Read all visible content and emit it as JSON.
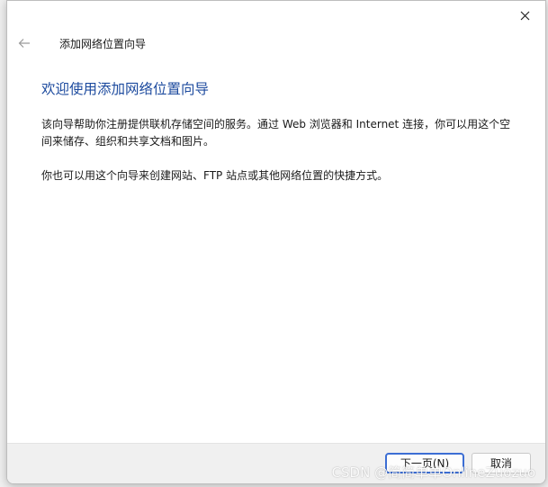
{
  "window": {
    "header_title": "添加网络位置向导"
  },
  "content": {
    "heading": "欢迎使用添加网络位置向导",
    "paragraph1": "该向导帮助你注册提供联机存储空间的服务。通过 Web 浏览器和 Internet 连接，你可以用这个空间来储存、组织和共享文档和图片。",
    "paragraph2": "你也可以用这个向导来创建网站、FTP 站点或其他网络位置的快捷方式。"
  },
  "footer": {
    "next_label": "下一页(N)",
    "cancel_label": "取消"
  },
  "watermark": "CSDN @简简单单OnlineZuozuo",
  "icons": {
    "close": "close-icon",
    "back": "back-arrow-icon"
  },
  "colors": {
    "heading": "#1c4a9e",
    "primary_button_border": "#3c6ed4"
  }
}
